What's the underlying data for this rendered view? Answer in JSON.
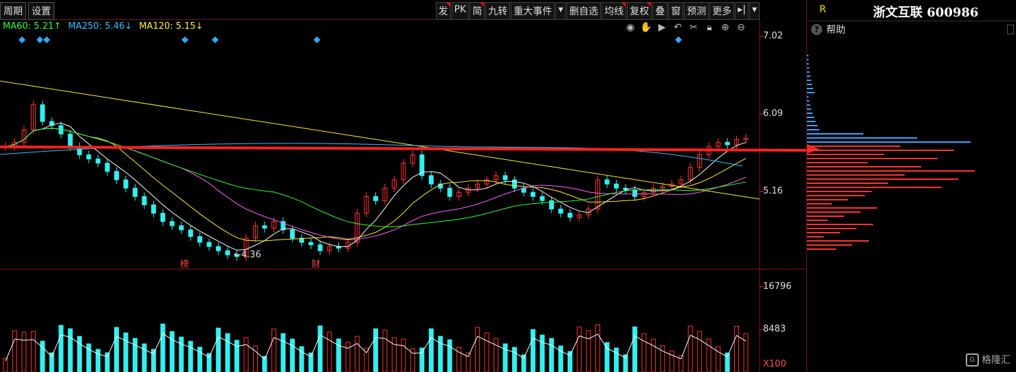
{
  "toolbar": {
    "left": [
      "周期",
      "设置"
    ],
    "right": [
      "发",
      "PK",
      "简",
      "九转",
      "重大事件",
      "▾",
      "删自选",
      "均线",
      "复权",
      "叠",
      "窗",
      "预测",
      "更多",
      "▸|",
      "▾"
    ]
  },
  "ma": {
    "ma60": "MA60: 5.21↑",
    "ma250": "MA250: 5.46↓",
    "ma120": "MA120: 5.15↓"
  },
  "colors": {
    "ma60": "#33ff33",
    "ma250": "#33c0ff",
    "ma120": "#ffee33",
    "up": "#ff3333",
    "down": "#33f0f0",
    "arrow": "#ff2222"
  },
  "price_axis": [
    "7.02",
    "6.09",
    "5.16"
  ],
  "volume_axis": [
    "16796",
    "8483",
    "X100"
  ],
  "annotations": {
    "low": "4.36",
    "bang": "榜",
    "cai": "财"
  },
  "stock": {
    "flag": "R",
    "title": "浙文互联 600986"
  },
  "help_label": "帮助",
  "watermark": "格隆汇",
  "tool_icons": [
    "eye-icon",
    "hand-icon",
    "play-icon",
    "undo-icon",
    "scissors-icon",
    "lock-icon",
    "zoom-in-icon",
    "zoom-out-icon"
  ]
}
